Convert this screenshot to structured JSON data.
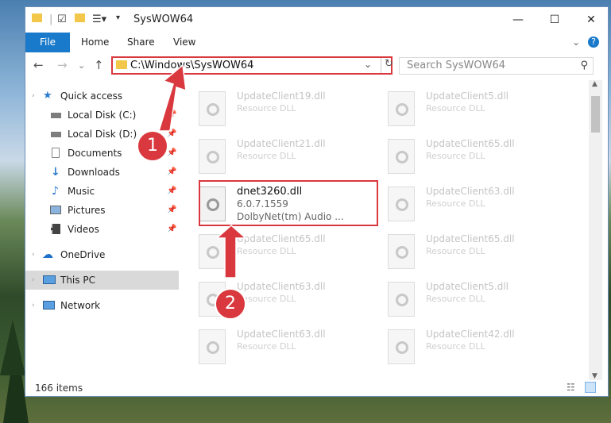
{
  "window": {
    "title": "SysWOW64",
    "controls": {
      "minimize": "—",
      "maximize": "☐",
      "close": "✕"
    }
  },
  "ribbon": {
    "tabs": [
      "File",
      "Home",
      "Share",
      "View"
    ],
    "expand": "⌄",
    "help": "?"
  },
  "address": {
    "path": "C:\\Windows\\SysWOW64",
    "dropdown": "⌄",
    "refresh": "↻"
  },
  "search": {
    "placeholder": "Search SysWOW64",
    "icon": "search-icon"
  },
  "nav": {
    "back": "←",
    "forward": "→",
    "recent": "⌄",
    "up": "↑"
  },
  "sidebar": {
    "items": [
      {
        "label": "Quick access",
        "icon": "star-icon",
        "pinned": false
      },
      {
        "label": "Local Disk (C:)",
        "icon": "drive-icon",
        "pinned": true
      },
      {
        "label": "Local Disk (D:)",
        "icon": "drive-icon",
        "pinned": true
      },
      {
        "label": "Documents",
        "icon": "documents-icon",
        "pinned": true
      },
      {
        "label": "Downloads",
        "icon": "download-icon",
        "pinned": true
      },
      {
        "label": "Music",
        "icon": "music-icon",
        "pinned": true
      },
      {
        "label": "Pictures",
        "icon": "pictures-icon",
        "pinned": true
      },
      {
        "label": "Videos",
        "icon": "videos-icon",
        "pinned": true
      },
      {
        "label": "OneDrive",
        "icon": "cloud-icon",
        "pinned": false
      },
      {
        "label": "This PC",
        "icon": "monitor-icon",
        "pinned": false,
        "selected": true
      },
      {
        "label": "Network",
        "icon": "network-icon",
        "pinned": false
      }
    ]
  },
  "files": {
    "left": [
      {
        "name": "UpdateClient19.dll",
        "desc": "Resource DLL"
      },
      {
        "name": "UpdateClient21.dll",
        "desc": "Resource DLL"
      },
      {
        "name": "dnet3260.dll",
        "version": "6.0.7.1559",
        "desc": "DolbyNet(tm) Audio ...",
        "highlighted": true
      },
      {
        "name": "UpdateClient65.dll",
        "desc": "Resource DLL"
      },
      {
        "name": "UpdateClient63.dll",
        "desc": "Resource DLL"
      },
      {
        "name": "UpdateClient63.dll",
        "desc": "Resource DLL"
      }
    ],
    "right": [
      {
        "name": "UpdateClient5.dll",
        "desc": "Resource DLL"
      },
      {
        "name": "UpdateClient65.dll",
        "desc": "Resource DLL"
      },
      {
        "name": "UpdateClient63.dll",
        "desc": "Resource DLL"
      },
      {
        "name": "UpdateClient65.dll",
        "desc": "Resource DLL"
      },
      {
        "name": "UpdateClient5.dll",
        "desc": "Resource DLL"
      },
      {
        "name": "UpdateClient42.dll",
        "desc": "Resource DLL"
      }
    ]
  },
  "status": {
    "count": "166 items"
  },
  "callouts": [
    "1",
    "2"
  ],
  "colors": {
    "accent": "#1979ca",
    "highlight": "#d9393e",
    "folder": "#f3c84a"
  }
}
